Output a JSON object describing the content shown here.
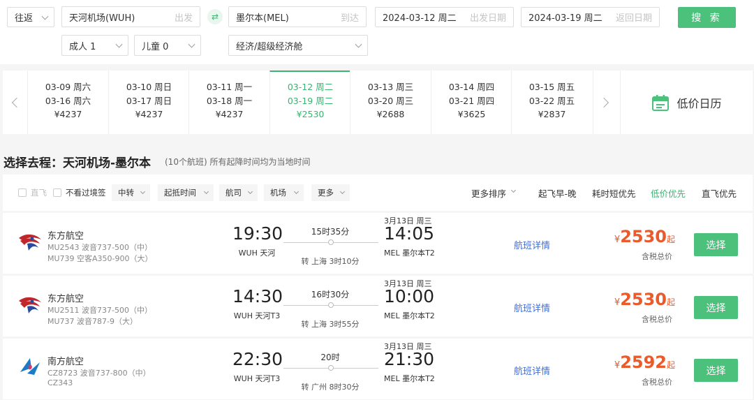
{
  "search": {
    "trip_type": "往返",
    "from_value": "天河机场(WUH)",
    "from_hint": "出发",
    "to_value": "墨尔本(MEL)",
    "to_hint": "到达",
    "depart_date": "2024-03-12 周二",
    "depart_hint": "出发日期",
    "return_date": "2024-03-19 周二",
    "return_hint": "返回日期",
    "search_label": "搜 索",
    "adults": "成人 1",
    "children": "儿童 0",
    "cabin": "经济/超级经济舱"
  },
  "date_strip": {
    "cells": [
      {
        "out": "03-09 周六",
        "ret": "03-16 周六",
        "price": "¥4237"
      },
      {
        "out": "03-10 周日",
        "ret": "03-17 周日",
        "price": "¥4237"
      },
      {
        "out": "03-11 周一",
        "ret": "03-18 周一",
        "price": "¥4237"
      },
      {
        "out": "03-12 周二",
        "ret": "03-19 周二",
        "price": "¥2530"
      },
      {
        "out": "03-13 周三",
        "ret": "03-20 周三",
        "price": "¥2688"
      },
      {
        "out": "03-14 周四",
        "ret": "03-21 周四",
        "price": "¥3625"
      },
      {
        "out": "03-15 周五",
        "ret": "03-22 周五",
        "price": "¥2837"
      }
    ],
    "calendar_label": "低价日历"
  },
  "route": {
    "title": "选择去程：天河机场-墨尔本",
    "subtitle": "(10个航班) 所有起降时间均为当地时间"
  },
  "filters": {
    "direct_label": "直飞",
    "no_transit_visa_label": "不看过境签",
    "buttons": [
      "中转",
      "起抵时间",
      "航司",
      "机场",
      "更多"
    ],
    "sorts": [
      "更多排序",
      "起飞早-晚",
      "耗时短优先",
      "低价优先",
      "直飞优先"
    ]
  },
  "flights": [
    {
      "airline": "东方航空",
      "fno1": "MU2543 波音737-500（中）",
      "fno2": "MU739 空客A350-900（大）",
      "dep_time": "19:30",
      "dep_airport": "WUH 天河",
      "duration": "15时35分",
      "stop": "转 上海 3时10分",
      "arr_date": "3月13日 周三",
      "arr_time": "14:05",
      "arr_airport": "MEL 墨尔本T2",
      "detail": "航班详情",
      "yen": "¥",
      "price": "2530",
      "qi": "起",
      "tax": "含税总价",
      "select": "选择"
    },
    {
      "airline": "东方航空",
      "fno1": "MU2511 波音737-500（中）",
      "fno2": "MU737 波音787-9（大）",
      "dep_time": "14:30",
      "dep_airport": "WUH 天河T3",
      "duration": "16时30分",
      "stop": "转 上海 3时55分",
      "arr_date": "3月13日 周三",
      "arr_time": "10:00",
      "arr_airport": "MEL 墨尔本T2",
      "detail": "航班详情",
      "yen": "¥",
      "price": "2530",
      "qi": "起",
      "tax": "含税总价",
      "select": "选择"
    },
    {
      "airline": "南方航空",
      "fno1": "CZ8723 波音737-800（中）",
      "fno2": "CZ343",
      "dep_time": "22:30",
      "dep_airport": "WUH 天河T3",
      "duration": "20时",
      "stop": "转 广州 8时30分",
      "arr_date": "3月13日 周三",
      "arr_time": "21:30",
      "arr_airport": "MEL 墨尔本T2",
      "detail": "航班详情",
      "yen": "¥",
      "price": "2592",
      "qi": "起",
      "tax": "含税总价",
      "select": "选择"
    }
  ],
  "colors": {
    "accent": "#3cb371",
    "button": "#4cc17b",
    "price": "#e95a2c",
    "link": "#3f6fd8"
  }
}
